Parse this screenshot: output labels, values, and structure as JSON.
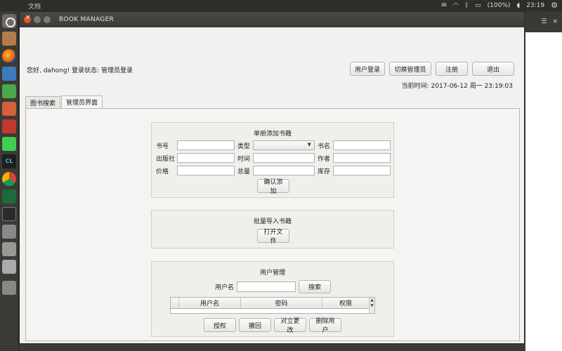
{
  "system": {
    "app_title": "文档",
    "battery": "(100%)",
    "clock": "23:19"
  },
  "window": {
    "title": "BOOK MANAGER"
  },
  "header": {
    "greeting": "您好, dahong! 登录状态:  管理员登录",
    "buttons": [
      "用户登录",
      "切换管理员",
      "注册",
      "退出"
    ],
    "current_time": "当前时间: 2017-06-12 周一 23:19:03"
  },
  "tabs": [
    "图书搜索",
    "管理员界面"
  ],
  "add_book": {
    "title": "单册添加书籍",
    "labels": [
      "书号",
      "类型",
      "书名",
      "出版社",
      "时间",
      "作者",
      "价格",
      "总量",
      "库存"
    ],
    "confirm_label": "确认添加"
  },
  "batch_import": {
    "title": "批量导入书籍",
    "open_file_label": "打开文件"
  },
  "user_mgmt": {
    "title": "用户管理",
    "username_label": "用户名",
    "search_label": "搜索",
    "columns": [
      "用户名",
      "密码",
      "权限"
    ],
    "buttons": [
      "授权",
      "撤回",
      "对立更改",
      "删除用户"
    ]
  },
  "colors": {
    "accent_close": "#e95420",
    "panel_dark": "#3c3b37"
  }
}
